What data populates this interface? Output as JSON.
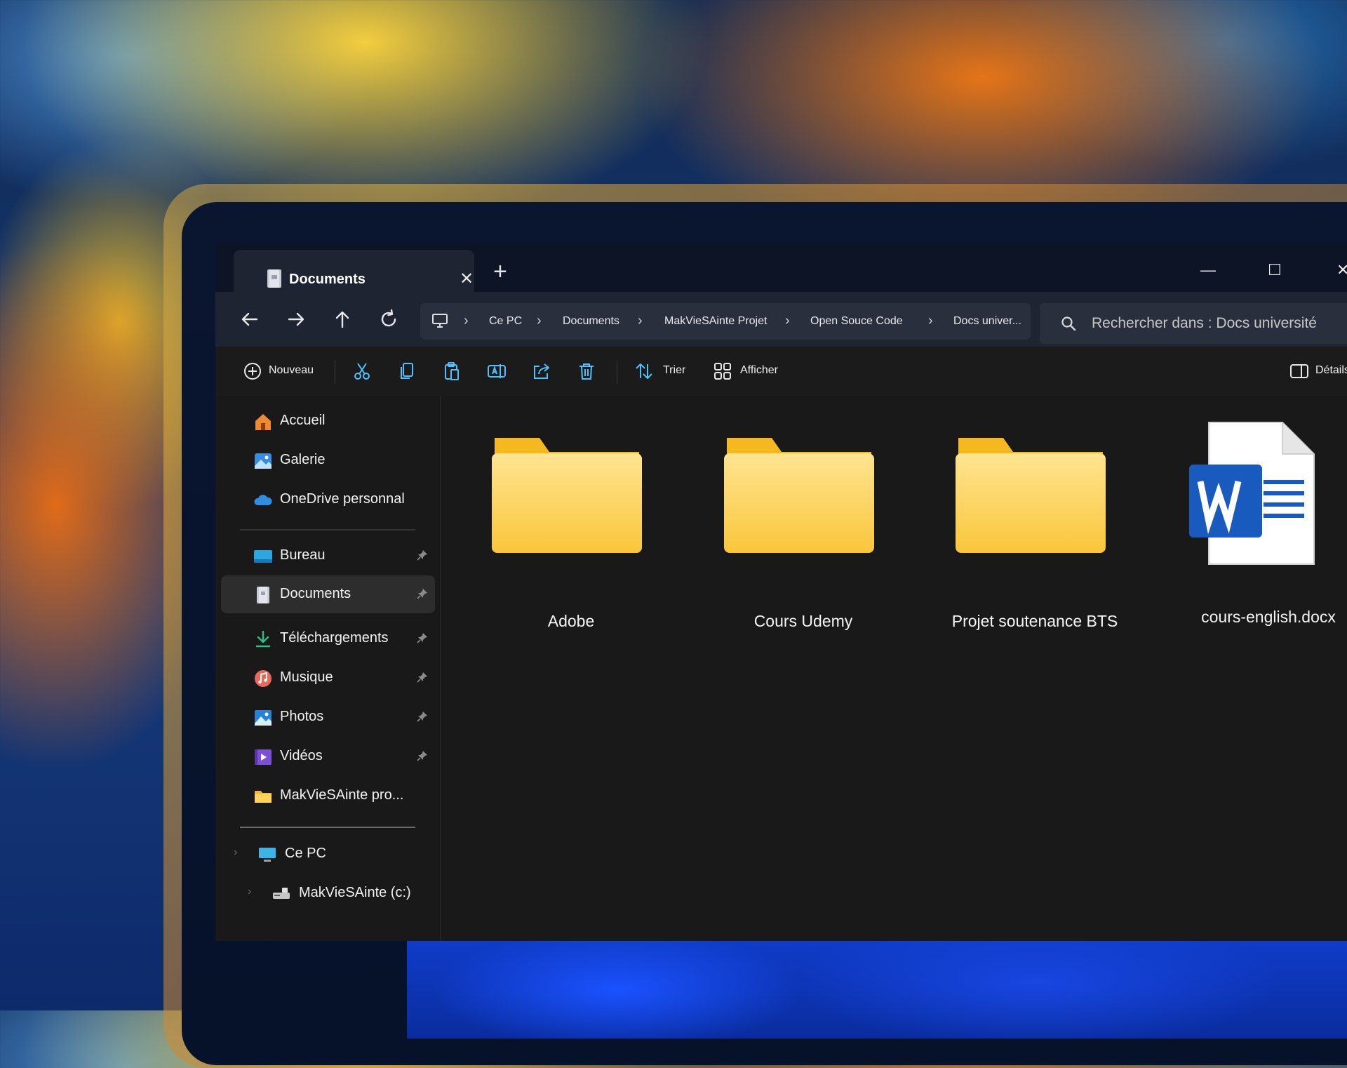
{
  "window": {
    "tab_title": "Documents",
    "tab_close": "✕",
    "new_tab": "+",
    "minimize": "—",
    "maximize": "☐",
    "close": "✕"
  },
  "address": {
    "crumbs": [
      "Ce PC",
      "Documents",
      "MakVieSAinte Projet",
      "Open Souce Code",
      "Docs univer..."
    ],
    "separator": "›",
    "search_placeholder": "Rechercher dans : Docs université"
  },
  "toolbar": {
    "new_label": "Nouveau",
    "sort_label": "Trier",
    "view_label": "Afficher",
    "details_label": "Détails"
  },
  "sidebar": {
    "quick": [
      {
        "label": "Accueil",
        "icon": "home-icon"
      },
      {
        "label": "Galerie",
        "icon": "gallery-icon"
      },
      {
        "label": "OneDrive personnal",
        "icon": "onedrive-icon"
      }
    ],
    "pinned": [
      {
        "label": "Bureau",
        "icon": "desktop-icon"
      },
      {
        "label": "Documents",
        "icon": "documents-icon",
        "active": true
      },
      {
        "label": "Téléchargements",
        "icon": "download-icon"
      },
      {
        "label": "Musique",
        "icon": "music-icon"
      },
      {
        "label": "Photos",
        "icon": "photos-icon"
      },
      {
        "label": "Vidéos",
        "icon": "videos-icon"
      }
    ],
    "extra": {
      "label": "MakVieSAinte pro...",
      "icon": "folder-icon"
    },
    "this_pc": {
      "label": "Ce PC",
      "icon": "computer-icon"
    },
    "drive": {
      "label": "MakVieSAinte (c:)",
      "icon": "drive-icon"
    }
  },
  "files": [
    {
      "name": "Adobe",
      "type": "folder"
    },
    {
      "name": "Cours Udemy",
      "type": "folder"
    },
    {
      "name": "Projet soutenance BTS",
      "type": "folder"
    },
    {
      "name": "cours-english.docx",
      "type": "word"
    }
  ],
  "colors": {
    "folder": "#ffd35a",
    "folder_tab": "#f5b81e",
    "word_blue": "#185abd",
    "accent": "#4cc2ff"
  }
}
